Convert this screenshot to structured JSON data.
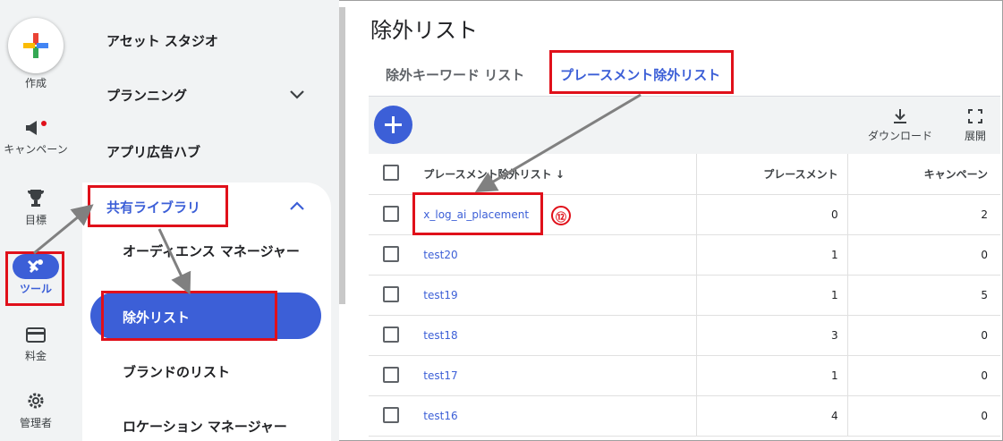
{
  "rail": {
    "create_label": "作成",
    "items": [
      {
        "label": "キャンペーン",
        "icon": "megaphone-icon"
      },
      {
        "label": "目標",
        "icon": "trophy-icon"
      },
      {
        "label": "ツール",
        "icon": "tools-icon"
      },
      {
        "label": "料金",
        "icon": "credit-card-icon"
      },
      {
        "label": "管理者",
        "icon": "gear-icon"
      }
    ]
  },
  "nav": {
    "asset_studio": "アセット スタジオ",
    "planning": "プランニング",
    "app_ads_hub": "アプリ広告ハブ",
    "shared_library": "共有ライブラリ",
    "audience_manager": "オーディエンス マネージャー",
    "exclusion_lists": "除外リスト",
    "brand_lists": "ブランドのリスト",
    "location_manager": "ロケーション マネージャー"
  },
  "main": {
    "title": "除外リスト",
    "tabs": [
      {
        "label": "除外キーワード リスト",
        "active": false
      },
      {
        "label": "プレースメント除外リスト",
        "active": true
      }
    ],
    "toolbar": {
      "download_label": "ダウンロード",
      "expand_label": "展開"
    },
    "table": {
      "headers": [
        "プレースメント除外リスト ↓",
        "プレースメント",
        "キャンペーン"
      ],
      "rows": [
        {
          "name": "x_log_ai_placement",
          "placements": "0",
          "campaigns": "2"
        },
        {
          "name": "test20",
          "placements": "1",
          "campaigns": "0"
        },
        {
          "name": "test19",
          "placements": "1",
          "campaigns": "5"
        },
        {
          "name": "test18",
          "placements": "3",
          "campaigns": "0"
        },
        {
          "name": "test17",
          "placements": "1",
          "campaigns": "0"
        },
        {
          "name": "test16",
          "placements": "4",
          "campaigns": "0"
        }
      ]
    }
  },
  "annotation": {
    "step": "⑫"
  },
  "colors": {
    "accent": "#3c5fd7",
    "highlight": "#e0101a",
    "arrow": "#808080"
  }
}
